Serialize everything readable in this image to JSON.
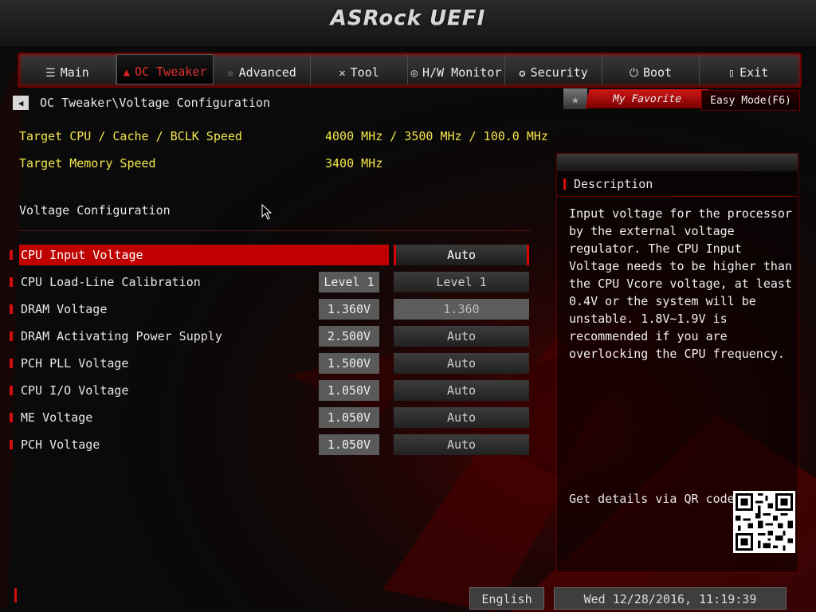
{
  "header": {
    "logo": "ASRock UEFI"
  },
  "tabs": [
    {
      "label": "Main",
      "icon": "list-icon"
    },
    {
      "label": "OC Tweaker",
      "icon": "flame-icon",
      "active": true
    },
    {
      "label": "Advanced",
      "icon": "star-icon"
    },
    {
      "label": "Tool",
      "icon": "wrench-icon"
    },
    {
      "label": "H/W Monitor",
      "icon": "gauge-icon"
    },
    {
      "label": "Security",
      "icon": "shield-icon"
    },
    {
      "label": "Boot",
      "icon": "power-icon"
    },
    {
      "label": "Exit",
      "icon": "door-icon"
    }
  ],
  "breadcrumb": "OC Tweaker\\Voltage Configuration",
  "favorite": {
    "label": "My Favorite"
  },
  "easy_mode": {
    "label": "Easy Mode(F6)"
  },
  "info": [
    {
      "label": "Target CPU / Cache / BCLK Speed",
      "value": "4000 MHz / 3500 MHz / 100.0 MHz"
    },
    {
      "label": "Target Memory Speed",
      "value": "3400 MHz"
    }
  ],
  "section_title": "Voltage Configuration",
  "settings": [
    {
      "label": "CPU Input Voltage",
      "current": "",
      "value": "Auto",
      "selected": true
    },
    {
      "label": "CPU Load-Line Calibration",
      "current": "Level 1",
      "value": "Level 1"
    },
    {
      "label": "DRAM Voltage",
      "current": "1.360V",
      "value": "1.360"
    },
    {
      "label": "DRAM Activating Power Supply",
      "current": "2.500V",
      "value": "Auto"
    },
    {
      "label": "PCH PLL Voltage",
      "current": "1.500V",
      "value": "Auto"
    },
    {
      "label": "CPU I/O Voltage",
      "current": "1.050V",
      "value": "Auto"
    },
    {
      "label": "ME Voltage",
      "current": "1.050V",
      "value": "Auto"
    },
    {
      "label": "PCH Voltage",
      "current": "1.050V",
      "value": "Auto"
    }
  ],
  "description": {
    "title": "Description",
    "text": "Input voltage for the processor by the external voltage regulator. The CPU Input Voltage needs to be higher than the CPU Vcore voltage, at least 0.4V or the system will be unstable. 1.8V~1.9V is recommended if you are overlocking the CPU frequency.",
    "qr_label": "Get details via QR code"
  },
  "footer": {
    "language": "English",
    "datetime": "Wed 12/28/2016, 11:19:39"
  },
  "colors": {
    "accent": "#c00000",
    "highlight_text": "#f4e64a"
  }
}
